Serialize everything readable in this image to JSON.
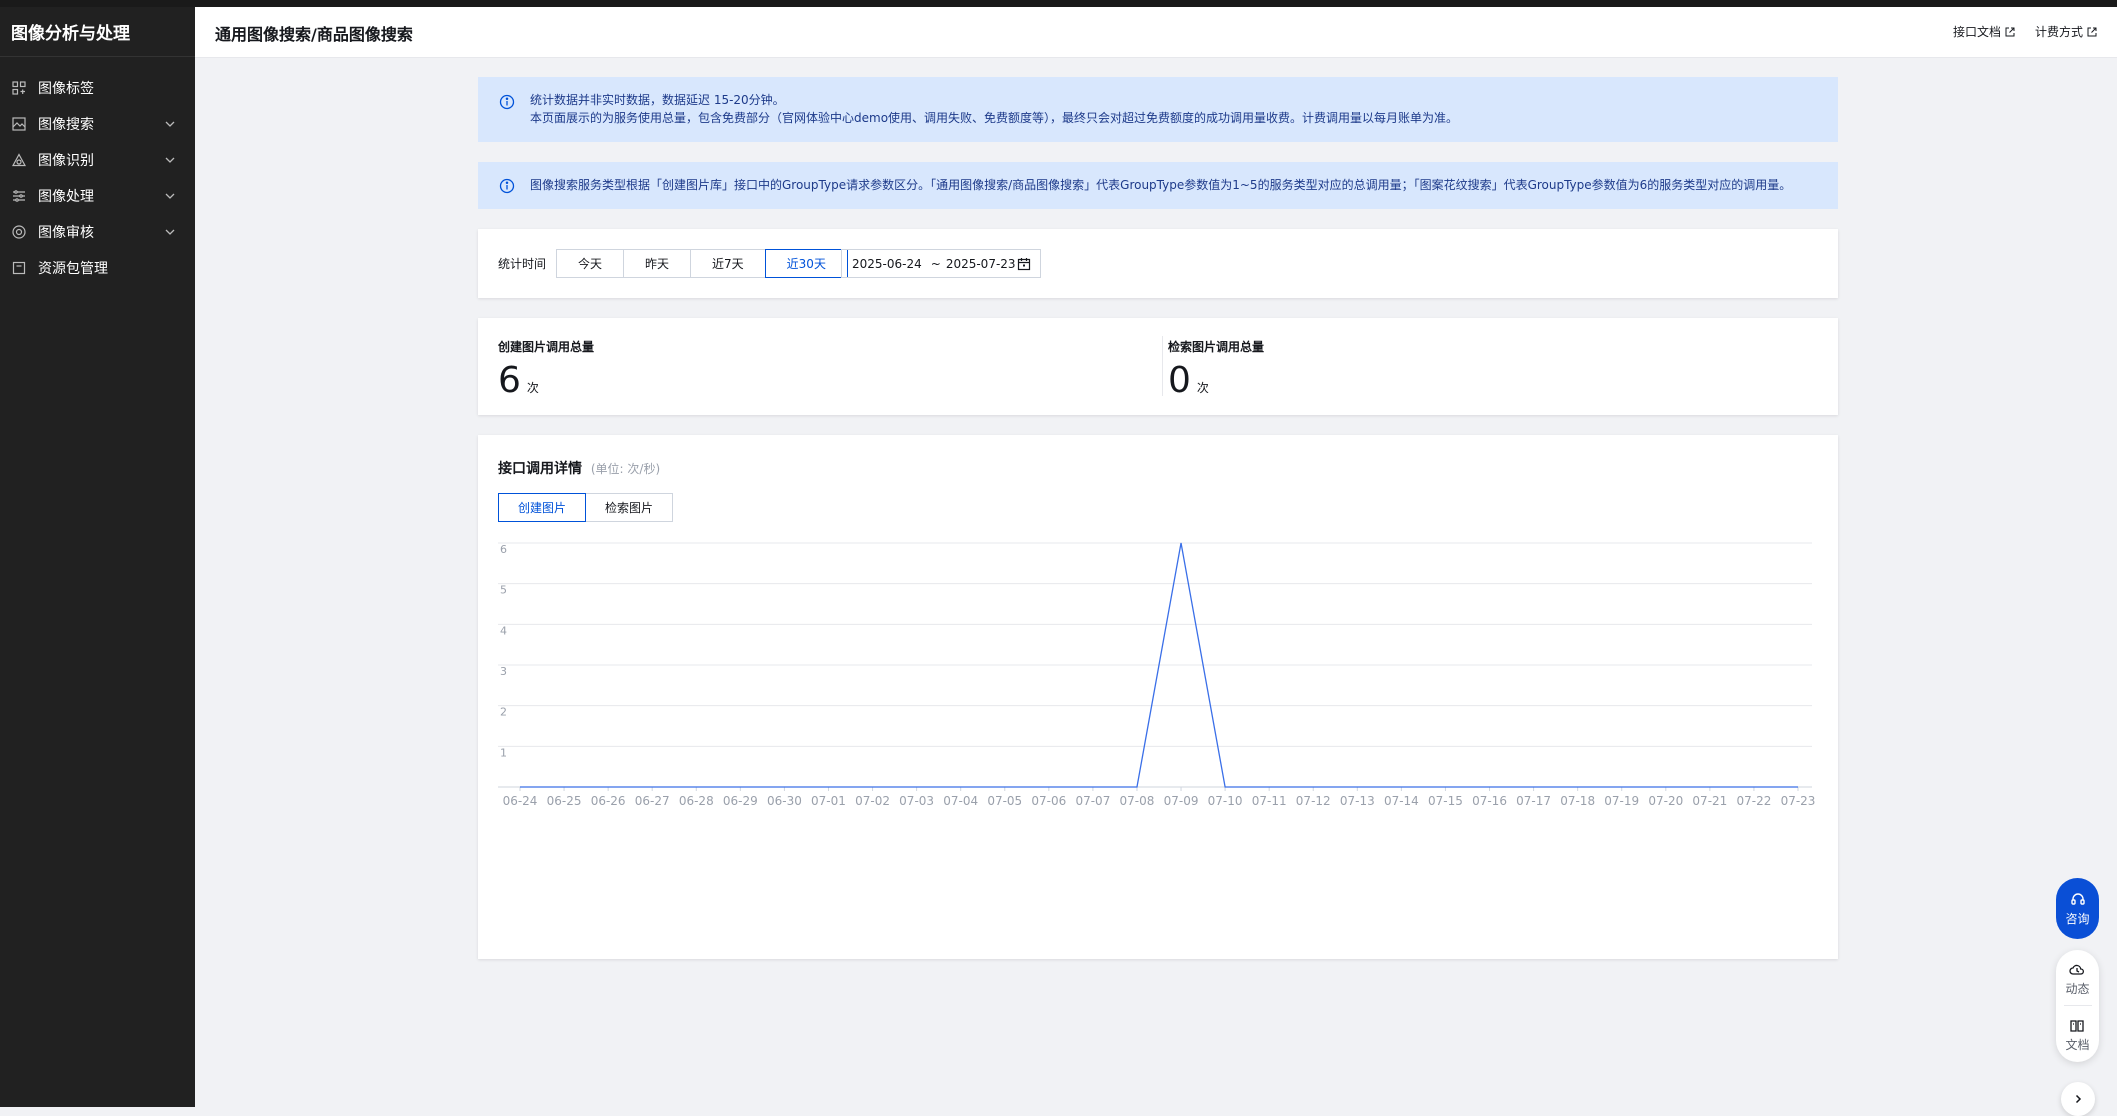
{
  "sidebar": {
    "title": "图像分析与处理",
    "items": [
      {
        "label": "图像标签",
        "icon": "tag-grid-icon",
        "expandable": false
      },
      {
        "label": "图像搜索",
        "icon": "image-icon",
        "expandable": true
      },
      {
        "label": "图像识别",
        "icon": "triangle-shapes-icon",
        "expandable": true
      },
      {
        "label": "图像处理",
        "icon": "sliders-icon",
        "expandable": true
      },
      {
        "label": "图像审核",
        "icon": "shield-check-icon",
        "expandable": true
      },
      {
        "label": "资源包管理",
        "icon": "package-icon",
        "expandable": false
      }
    ]
  },
  "header": {
    "title": "通用图像搜索/商品图像搜索",
    "api_doc": "接口文档",
    "billing": "计费方式"
  },
  "notices": {
    "notice1_line1": "统计数据并非实时数据，数据延迟 15-20分钟。",
    "notice1_line2": "本页面展示的为服务使用总量，包含免费部分（官网体验中心demo使用、调用失败、免费额度等），最终只会对超过免费额度的成功调用量收费。计费调用量以每月账单为准。",
    "notice2": "图像搜索服务类型根据「创建图片库」接口中的GroupType请求参数区分。「通用图像搜索/商品图像搜索」代表GroupType参数值为1~5的服务类型对应的总调用量；「图案花纹搜索」代表GroupType参数值为6的服务类型对应的调用量。"
  },
  "filter": {
    "label": "统计时间",
    "ranges": [
      "今天",
      "昨天",
      "近7天",
      "近30天"
    ],
    "active_range": "近30天",
    "date_start": "2025-06-24",
    "date_sep": "~",
    "date_end": "2025-07-23"
  },
  "stats": {
    "create_label": "创建图片调用总量",
    "create_value": "6",
    "search_label": "检索图片调用总量",
    "search_value": "0",
    "unit": "次"
  },
  "chart_section": {
    "title": "接口调用详情",
    "unit": "(单位: 次/秒)",
    "tabs": [
      "创建图片",
      "检索图片"
    ],
    "active_tab": "创建图片"
  },
  "chart_data": {
    "type": "line",
    "x": [
      "06-24",
      "06-25",
      "06-26",
      "06-27",
      "06-28",
      "06-29",
      "06-30",
      "07-01",
      "07-02",
      "07-03",
      "07-04",
      "07-05",
      "07-06",
      "07-07",
      "07-08",
      "07-09",
      "07-10",
      "07-11",
      "07-12",
      "07-13",
      "07-14",
      "07-15",
      "07-16",
      "07-17",
      "07-18",
      "07-19",
      "07-20",
      "07-21",
      "07-22",
      "07-23"
    ],
    "series": [
      {
        "values": [
          0,
          0,
          0,
          0,
          0,
          0,
          0,
          0,
          0,
          0,
          0,
          0,
          0,
          0,
          0,
          6,
          0,
          0,
          0,
          0,
          0,
          0,
          0,
          0,
          0,
          0,
          0,
          0,
          0,
          0
        ],
        "color": "#3a6fe8"
      }
    ],
    "yticks": [
      1,
      2,
      3,
      4,
      5,
      6
    ],
    "ylim": [
      0,
      6
    ],
    "grid": true
  },
  "floating": {
    "consult": "咨询",
    "updates": "动态",
    "docs": "文档"
  },
  "colors": {
    "primary": "#0052d9",
    "notice_bg": "#d8e7fd",
    "sidebar_bg": "#212121"
  }
}
